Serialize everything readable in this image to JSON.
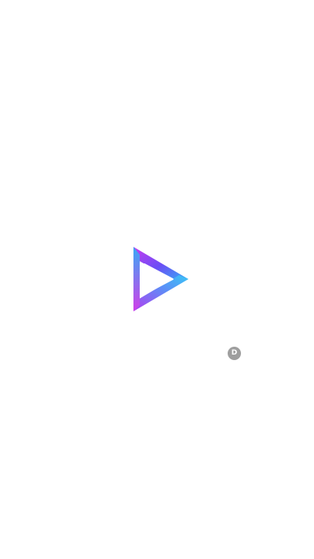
{
  "splash": {
    "logo_icon": "triangle-play-logo-icon",
    "colors": {
      "background": "#ffffff",
      "logo_gradient_start": "#c63cf0",
      "logo_gradient_mid": "#6b4ef5",
      "logo_gradient_end": "#2fb8f5",
      "badge_background": "#9e9e9e",
      "badge_text": "#ffffff"
    },
    "badge": {
      "label": "D"
    }
  }
}
